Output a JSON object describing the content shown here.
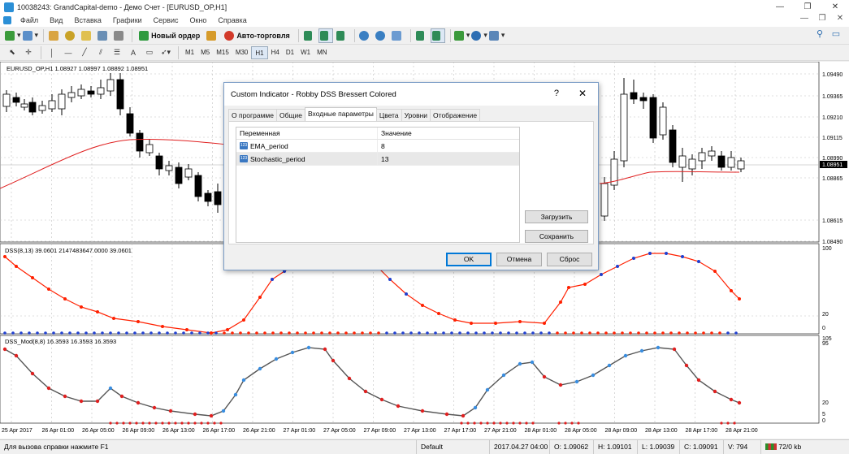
{
  "window": {
    "title": "10038243: GrandCapital-demo - Демо Счет - [EURUSD_OP,H1]"
  },
  "menu": [
    "Файл",
    "Вид",
    "Вставка",
    "Графики",
    "Сервис",
    "Окно",
    "Справка"
  ],
  "toolbar": {
    "new_order": "Новый ордер",
    "auto_trading": "Авто-торговля",
    "drawing_text": "A",
    "timeframes": [
      "M1",
      "M5",
      "M15",
      "M30",
      "H1",
      "H4",
      "D1",
      "W1",
      "MN"
    ],
    "active_timeframe": "H1"
  },
  "chart": {
    "main_label": "EURUSD_OP,H1  1.08927 1.08997 1.08892 1.08951",
    "price_axis": [
      "1.09490",
      "1.09365",
      "1.09210",
      "1.09115",
      "1.08990",
      "1.08865",
      "1.08615",
      "1.08490"
    ],
    "current_price": "1.08951",
    "dss_label": "DSS(8,13) 39.0601 2147483647.0000 39.0601",
    "dss_axis": [
      "100",
      "20",
      "0"
    ],
    "dssmod_label": "DSS_Mod(8,8) 16.3593 16.3593 16.3593",
    "dssmod_axis": [
      "105",
      "95",
      "20",
      "5",
      "0"
    ],
    "time_axis": [
      "25 Apr 2017",
      "26 Apr 01:00",
      "26 Apr 05:00",
      "26 Apr 09:00",
      "26 Apr 13:00",
      "26 Apr 17:00",
      "26 Apr 21:00",
      "27 Apr 01:00",
      "27 Apr 05:00",
      "27 Apr 09:00",
      "27 Apr 13:00",
      "27 Apr 17:00",
      "27 Apr 21:00",
      "28 Apr 01:00",
      "28 Apr 05:00",
      "28 Apr 09:00",
      "28 Apr 13:00",
      "28 Apr 17:00",
      "28 Apr 21:00"
    ],
    "colors": {
      "bull": "#ffffff",
      "bear": "#000000",
      "ema": "#e02020",
      "dss": "#ff2000",
      "dss_dot_up": "#1f3fd0",
      "dssmod_line": "#555555",
      "dssmod_up": "#3a8ee0",
      "dssmod_down": "#e02020"
    }
  },
  "dialog": {
    "title": "Custom Indicator - Robby DSS Bressert Colored",
    "help": "?",
    "close": "✕",
    "tabs": [
      "О программе",
      "Общие",
      "Входные параметры",
      "Цвета",
      "Уровни",
      "Отображение"
    ],
    "active_tab": 2,
    "table": {
      "headers": [
        "Переменная",
        "Значение"
      ],
      "rows": [
        {
          "icon": "123",
          "name": "EMA_period",
          "value": "8"
        },
        {
          "icon": "123",
          "name": "Stochastic_period",
          "value": "13"
        }
      ]
    },
    "load_button": "Загрузить",
    "save_button": "Сохранить",
    "ok_button": "OK",
    "cancel_button": "Отмена",
    "reset_button": "Сброс"
  },
  "status": {
    "help": "Для вызова справки нажмите F1",
    "profile": "Default",
    "datetime": "2017.04.27 04:00",
    "open": "O: 1.09062",
    "high": "H: 1.09101",
    "low": "L: 1.09039",
    "close": "C: 1.09091",
    "volume": "V: 794",
    "traffic": "72/0 kb"
  }
}
